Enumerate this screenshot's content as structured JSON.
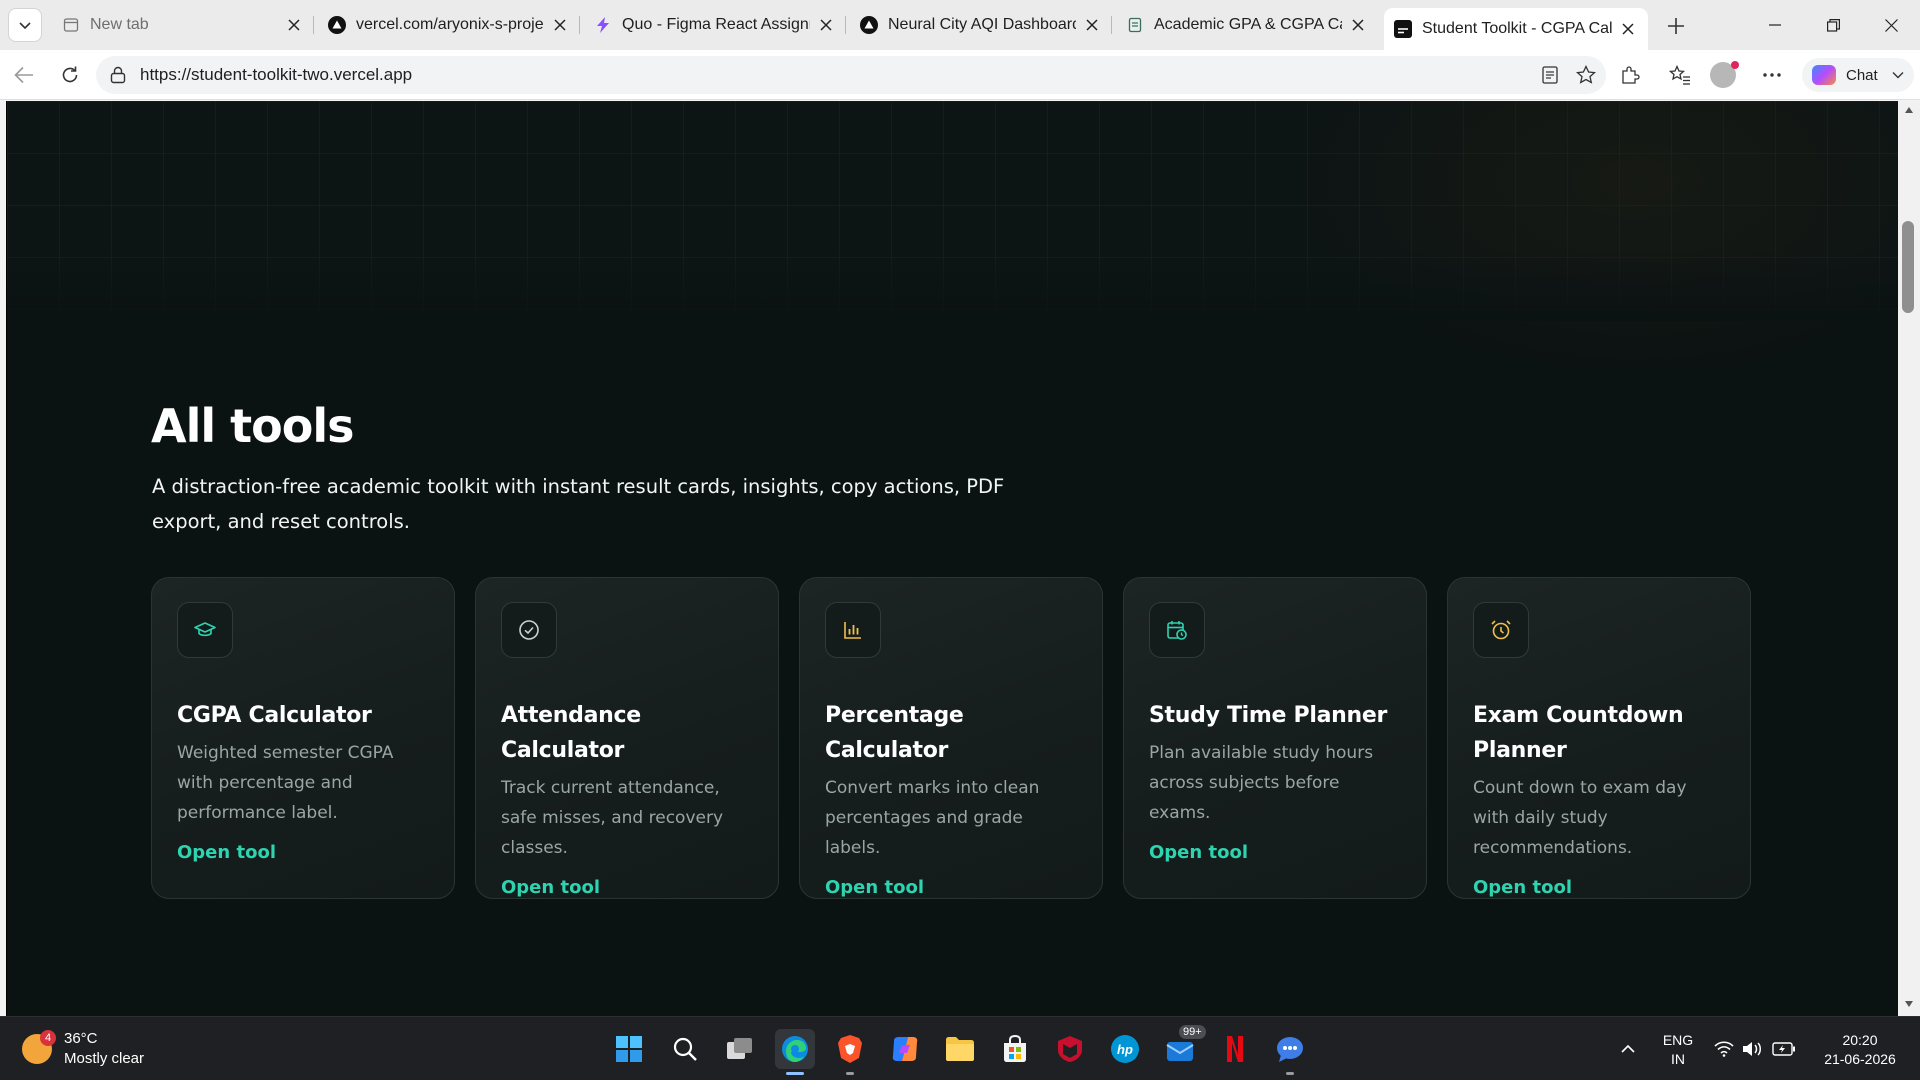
{
  "browser": {
    "tabs": [
      {
        "title": "New tab",
        "favicon": "new-tab-icon"
      },
      {
        "title": "vercel.com/aryonix-s-projects",
        "favicon": "vercel-icon"
      },
      {
        "title": "Quo - Figma React Assignment",
        "favicon": "figma-bolt-icon"
      },
      {
        "title": "Neural City AQI Dashboard",
        "favicon": "vercel-icon"
      },
      {
        "title": "Academic GPA & CGPA Calculator",
        "favicon": "document-icon"
      },
      {
        "title": "Student Toolkit - CGPA Calculator",
        "favicon": "terminal-icon"
      }
    ],
    "url": "https://student-toolkit-two.vercel.app",
    "chat_label": "Chat"
  },
  "page": {
    "section_title": "All tools",
    "section_description": "A distraction-free academic toolkit with instant result cards, insights, copy actions, PDF export, and reset controls.",
    "accent_color": "#2ed3b0",
    "tools": [
      {
        "icon": "graduation-cap-icon",
        "title": "CGPA Calculator",
        "description": "Weighted semester CGPA with percentage and performance label.",
        "link": "Open tool",
        "icon_color": "#2ed3b0"
      },
      {
        "icon": "check-circle-icon",
        "title": "Attendance Calculator",
        "description": "Track current attendance, safe misses, and recovery classes.",
        "link": "Open tool",
        "icon_color": "#c9d1d1"
      },
      {
        "icon": "bar-chart-icon",
        "title": "Percentage Calculator",
        "description": "Convert marks into clean percentages and grade labels.",
        "link": "Open tool",
        "icon_color": "#f0c04a"
      },
      {
        "icon": "calendar-clock-icon",
        "title": "Study Time Planner",
        "description": "Plan available study hours across subjects before exams.",
        "link": "Open tool",
        "icon_color": "#2ed3b0"
      },
      {
        "icon": "alarm-clock-icon",
        "title": "Exam Countdown Planner",
        "description": "Count down to exam day with daily study recommendations.",
        "link": "Open tool",
        "icon_color": "#f0c04a"
      }
    ]
  },
  "taskbar": {
    "weather_temp": "36°C",
    "weather_desc": "Mostly clear",
    "weather_badge": "4",
    "notif_badge": "99+",
    "lang_line1": "ENG",
    "lang_line2": "IN",
    "time": "20:20",
    "date": "21-06-2026"
  }
}
